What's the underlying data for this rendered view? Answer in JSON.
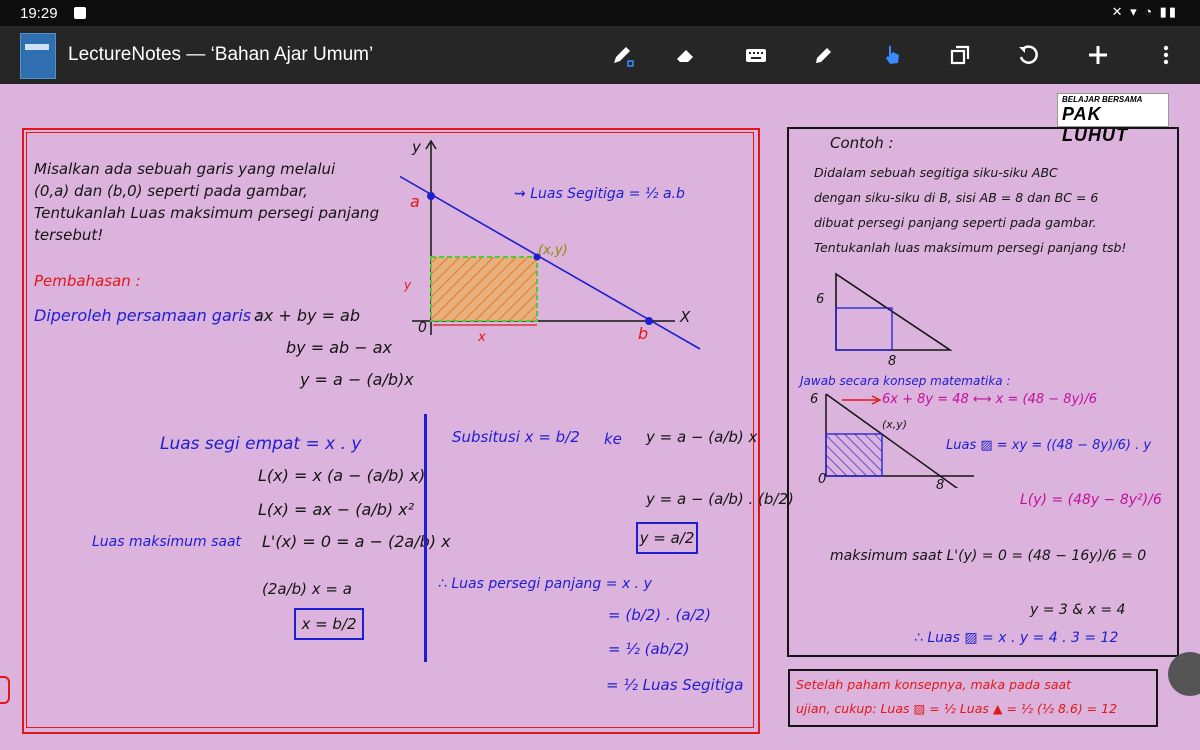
{
  "status": {
    "time": "19:29"
  },
  "app": {
    "title": "LectureNotes — ‘Bahan Ajar Umum’"
  },
  "toolbar": [
    "pen-icon",
    "eraser-icon",
    "keyboard-icon",
    "highlighter-icon",
    "hand-icon",
    "copy-icon",
    "undo-icon",
    "add-icon",
    "more-icon"
  ],
  "logo": {
    "small": "BELAJAR BERSAMA",
    "big": "PAK LUHUT"
  },
  "left": {
    "problem": [
      "Misalkan ada sebuah garis yang melalui",
      "(0,a) dan (b,0) seperti pada gambar,",
      "Tentukanlah Luas maksimum persegi panjang",
      "tersebut!"
    ],
    "pembahasan": "Pembahasan :",
    "diperoleh": "Diperoleh persamaan garis :",
    "eq1": "ax + by = ab",
    "eq2": "by = ab − ax",
    "eq3": "y = a − (a/b)x",
    "luas_segi": "Luas segi empat = x . y",
    "L1": "L(x) = x (a − (a/b) x)",
    "L2": "L(x) = ax − (a/b) x²",
    "luas_maks": "Luas maksimum saat",
    "L3": "L'(x) = 0 = a − (2a/b) x",
    "L4": "(2a/b) x = a",
    "xres": "x = b/2",
    "subs": "Subsitusi x = b/2",
    "ke": "ke",
    "subs_eq": "y = a − (a/b) x",
    "y1": "y = a − (a/b) . (b/2)",
    "yres": "y = a/2",
    "therefore": "∴ Luas persegi panjang = x . y",
    "t1": "= (b/2) . (a/2)",
    "t2": "= ½ (ab/2)",
    "t3": "= ½ Luas Segitiga"
  },
  "graph": {
    "xlabel": "X",
    "ylabel": "y",
    "a": "a",
    "b": "b",
    "origin": "0",
    "xy": "(x,y)",
    "xseg": "x",
    "yseg": "y",
    "arrow_note": "Luas Segitiga = ½ a.b"
  },
  "right": {
    "contoh": "Contoh :",
    "desc": [
      "Didalam sebuah segitiga siku-siku ABC",
      "dengan siku-siku di B, sisi AB = 8 dan BC = 6",
      "dibuat persegi panjang seperti pada gambar.",
      "Tentukanlah luas maksimum persegi panjang tsb!"
    ],
    "six": "6",
    "eight": "8",
    "jawab": "Jawab secara konsep matematika :",
    "e1": "6x + 8y = 48  ⟷  x = (48 − 8y)/6",
    "xy": "(x,y)",
    "zero": "0",
    "luas": "Luas ▨ = xy = ((48 − 8y)/6) . y",
    "ly": "L(y) = (48y − 8y²)/6",
    "maks": "maksimum saat  L'(y) = 0 = (48 − 16y)/6 = 0",
    "res": "y = 3  &  x = 4",
    "final": "∴ Luas ▨ = x . y = 4 . 3 = 12"
  },
  "redbox": [
    "Setelah paham konsepnya, maka pada saat",
    "ujian, cukup: Luas ▨ = ½ Luas ▲ = ½ (½ 8.6) = 12"
  ]
}
